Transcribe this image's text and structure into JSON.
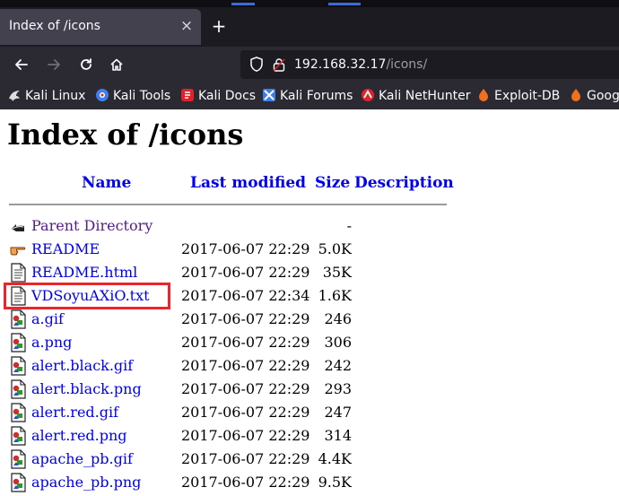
{
  "browser": {
    "tab_title": "Index of /icons",
    "tab_close": "×",
    "new_tab": "+",
    "url_host": "192.168.32.17",
    "url_path": "/icons/",
    "bookmarks": [
      {
        "label": "Kali Linux",
        "icon": "kali-dragon-icon",
        "color": "#dddddd"
      },
      {
        "label": "Kali Tools",
        "icon": "kali-tools-icon",
        "color": "#3d7ef0"
      },
      {
        "label": "Kali Docs",
        "icon": "kali-docs-icon",
        "color": "#e0232b"
      },
      {
        "label": "Kali Forums",
        "icon": "kali-forums-icon",
        "color": "#3d7ef0"
      },
      {
        "label": "Kali NetHunter",
        "icon": "nethunter-icon",
        "color": "#e0232b"
      },
      {
        "label": "Exploit-DB",
        "icon": "exploit-db-icon",
        "color": "#f0701e"
      },
      {
        "label": "Goog",
        "icon": "google-hacking-db-icon",
        "color": "#f0701e"
      }
    ]
  },
  "page": {
    "heading": "Index of /icons",
    "columns": {
      "name": "Name",
      "last_modified": "Last modified",
      "size": "Size",
      "description": "Description"
    },
    "entries": [
      {
        "name": "Parent Directory",
        "date": "",
        "size": "-",
        "icon": "back-arrow-icon",
        "visited": true
      },
      {
        "name": "README",
        "date": "2017-06-07 22:29",
        "size": "5.0K",
        "icon": "hand-pointer-icon",
        "visited": false
      },
      {
        "name": "README.html",
        "date": "2017-06-07 22:29",
        "size": "35K",
        "icon": "text-file-icon",
        "visited": false
      },
      {
        "name": "VDSoyuAXiO.txt",
        "date": "2017-06-07 22:34",
        "size": "1.6K",
        "icon": "text-file-icon",
        "visited": false
      },
      {
        "name": "a.gif",
        "date": "2017-06-07 22:29",
        "size": "246",
        "icon": "image-file-icon",
        "visited": false
      },
      {
        "name": "a.png",
        "date": "2017-06-07 22:29",
        "size": "306",
        "icon": "image-file-icon",
        "visited": false
      },
      {
        "name": "alert.black.gif",
        "date": "2017-06-07 22:29",
        "size": "242",
        "icon": "image-file-icon",
        "visited": false
      },
      {
        "name": "alert.black.png",
        "date": "2017-06-07 22:29",
        "size": "293",
        "icon": "image-file-icon",
        "visited": false
      },
      {
        "name": "alert.red.gif",
        "date": "2017-06-07 22:29",
        "size": "247",
        "icon": "image-file-icon",
        "visited": false
      },
      {
        "name": "alert.red.png",
        "date": "2017-06-07 22:29",
        "size": "314",
        "icon": "image-file-icon",
        "visited": false
      },
      {
        "name": "apache_pb.gif",
        "date": "2017-06-07 22:29",
        "size": "4.4K",
        "icon": "image-file-icon",
        "visited": false
      },
      {
        "name": "apache_pb.png",
        "date": "2017-06-07 22:29",
        "size": "9.5K",
        "icon": "image-file-icon",
        "visited": false
      }
    ],
    "highlight_color": "#e8262c"
  }
}
